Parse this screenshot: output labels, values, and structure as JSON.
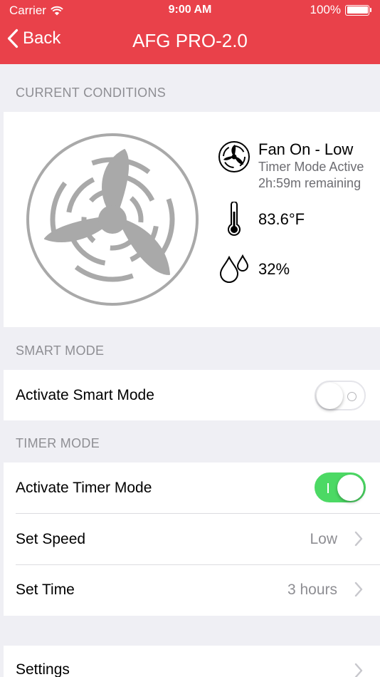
{
  "status_bar": {
    "carrier": "Carrier",
    "time": "9:00 AM",
    "battery": "100%",
    "battery_level": 1.0
  },
  "nav": {
    "back_label": "Back",
    "title": "AFG PRO-2.0",
    "background_color": "#e9414a"
  },
  "current_conditions": {
    "section_title": "CURRENT CONDITIONS",
    "fan_status": "Fan On - Low",
    "timer_status": "Timer Mode Active",
    "timer_remaining": "2h:59m remaining",
    "temperature": "83.6°F",
    "humidity": "32%",
    "icons": [
      "fan-icon",
      "thermometer-icon",
      "humidity-icon"
    ]
  },
  "smart_mode": {
    "section_title": "SMART MODE",
    "toggle_label": "Activate Smart Mode",
    "enabled": false
  },
  "timer_mode": {
    "section_title": "TIMER MODE",
    "toggle_label": "Activate Timer Mode",
    "enabled": true,
    "toggle_color": "#4cd964",
    "speed_label": "Set Speed",
    "speed_value": "Low",
    "time_label": "Set Time",
    "time_value": "3 hours"
  },
  "settings": {
    "label": "Settings"
  }
}
